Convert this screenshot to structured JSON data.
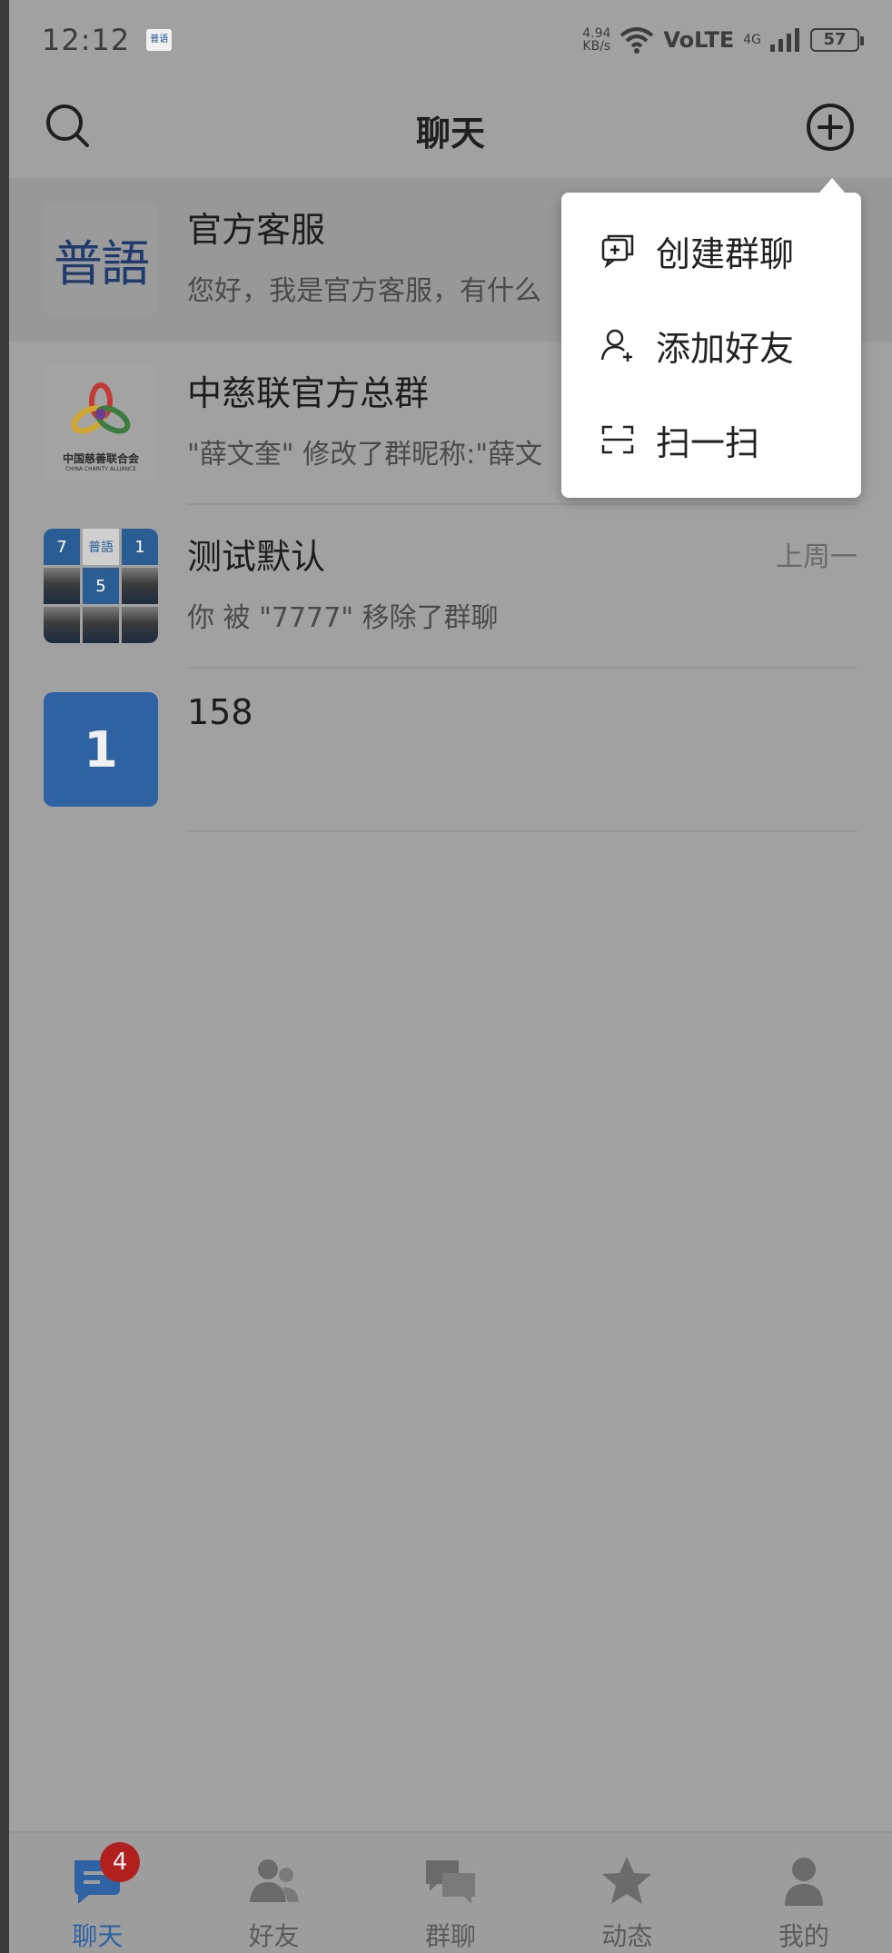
{
  "status_bar": {
    "time": "12:12",
    "app_icon_text": "普语",
    "net_speed_value": "4.94",
    "net_speed_unit": "KB/s",
    "network": "VoLTE",
    "network_gen": "4G",
    "battery": "57"
  },
  "header": {
    "title": "聊天"
  },
  "chats": [
    {
      "name": "官方客服",
      "preview": "您好，我是官方客服，有什么",
      "time": "",
      "avatar_text": "普語"
    },
    {
      "name": "中慈联官方总群",
      "preview": "\"薛文奎\" 修改了群昵称:\"薛文",
      "time": "",
      "avatar_text_cn": "中国慈善联合会",
      "avatar_text_en": "CHINA CHARITY ALLIANCE"
    },
    {
      "name": "测试默认",
      "preview": "你 被 \"7777\" 移除了群聊",
      "time": "上周一",
      "avatar_cells": [
        "7",
        "普語",
        "1",
        "",
        "5",
        "",
        "",
        "",
        ""
      ]
    },
    {
      "name": "158",
      "preview": "",
      "time": "",
      "avatar_text": "1"
    }
  ],
  "popup_menu": {
    "items": [
      {
        "label": "创建群聊",
        "icon": "create-group-icon"
      },
      {
        "label": "添加好友",
        "icon": "add-friend-icon"
      },
      {
        "label": "扫一扫",
        "icon": "scan-icon"
      }
    ]
  },
  "tab_bar": {
    "tabs": [
      {
        "label": "聊天",
        "icon": "chat-icon",
        "badge": "4",
        "active": true
      },
      {
        "label": "好友",
        "icon": "friends-icon"
      },
      {
        "label": "群聊",
        "icon": "group-chat-icon"
      },
      {
        "label": "动态",
        "icon": "star-icon"
      },
      {
        "label": "我的",
        "icon": "profile-icon"
      }
    ]
  },
  "colors": {
    "accent": "#2e62a3",
    "badge": "#b2201e",
    "dim_overlay_bg": "#a1a1a1"
  }
}
